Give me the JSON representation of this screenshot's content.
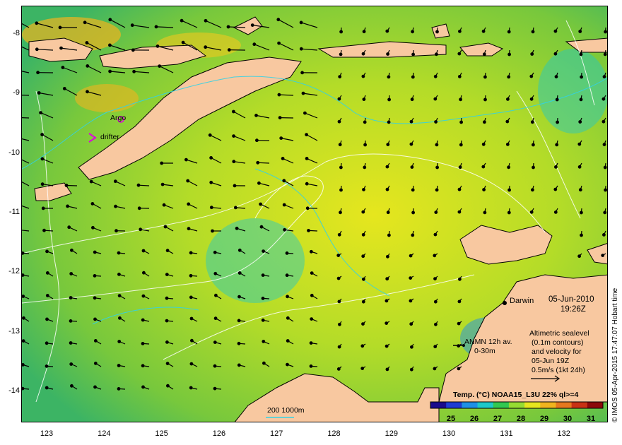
{
  "map": {
    "lat_labels": [
      "-8",
      "-9",
      "-10",
      "-11",
      "-12",
      "-13",
      "-14"
    ],
    "lon_labels": [
      "123",
      "124",
      "125",
      "126",
      "127",
      "128",
      "129",
      "130",
      "131",
      "132"
    ],
    "lat_range": [
      -14.5,
      -7.6
    ],
    "lon_range": [
      122.6,
      132.7
    ]
  },
  "markers": {
    "argo_label": "Argo",
    "drifter_label": "drifter",
    "marker_color": "#e000e0"
  },
  "place": {
    "darwin": "Darwin"
  },
  "datetime": {
    "date": "05-Jun-2010",
    "time": "19:26Z"
  },
  "anmn": {
    "line1": "ANMN 12h av.",
    "line2": "0-30m"
  },
  "altimetry": {
    "line1": "Altimetric sealevel",
    "line2": "(0.1m contours)",
    "line3": "and velocity for",
    "line4": "05-Jun 19Z",
    "line5": "0.5m/s (1kt 24h)"
  },
  "bathymetry": {
    "label": "200  1000m"
  },
  "colorbar": {
    "title": "Temp. (°C) NOAA15_L3U 22% ql>=4",
    "ticks": [
      "25",
      "26",
      "27",
      "28",
      "29",
      "30",
      "31"
    ],
    "colors": [
      "#1a0a8c",
      "#1e3cd2",
      "#1e90e6",
      "#1ec8c8",
      "#32c850",
      "#96dc32",
      "#e6e61e",
      "#f0b41e",
      "#e6781e",
      "#c83214",
      "#8c0a0a"
    ]
  },
  "credit": "© IMOS 05-Apr-2015 17:47:07 Hobart time"
}
